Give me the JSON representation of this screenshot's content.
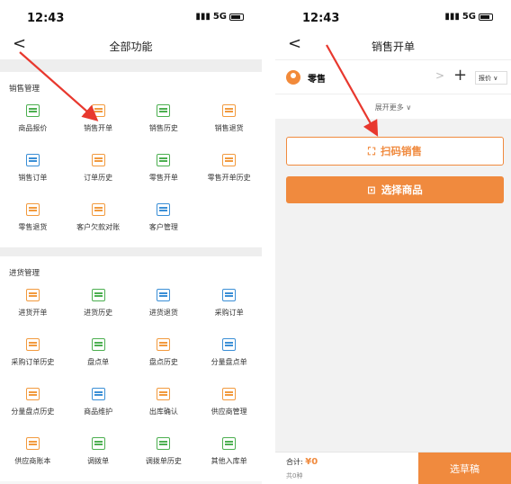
{
  "colors": {
    "accent": "#f08a3e",
    "arrow": "#e8382e",
    "icon_green": "#4caf50",
    "icon_orange": "#f29a3e",
    "icon_blue": "#3b8fd6"
  },
  "left": {
    "status": {
      "time": "12:43",
      "network": "5G"
    },
    "nav": {
      "back": "<",
      "title": "全部功能"
    },
    "sections": [
      {
        "title": "销售管理",
        "items": [
          {
            "label": "商品报价",
            "icon": "price-tag-icon",
            "color": "green"
          },
          {
            "label": "销售开单",
            "icon": "sales-order-icon",
            "color": "orange"
          },
          {
            "label": "销售历史",
            "icon": "history-icon",
            "color": "green"
          },
          {
            "label": "销售退货",
            "icon": "return-icon",
            "color": "orange"
          },
          {
            "label": "销售订单",
            "icon": "list-icon",
            "color": "blue"
          },
          {
            "label": "订单历史",
            "icon": "order-history-icon",
            "color": "orange"
          },
          {
            "label": "零售开单",
            "icon": "retail-order-icon",
            "color": "green"
          },
          {
            "label": "零售开单历史",
            "icon": "retail-history-icon",
            "color": "orange"
          },
          {
            "label": "零售退货",
            "icon": "retail-return-icon",
            "color": "orange"
          },
          {
            "label": "客户欠款对账",
            "icon": "debt-icon",
            "color": "orange"
          },
          {
            "label": "客户管理",
            "icon": "customer-icon",
            "color": "blue"
          }
        ]
      },
      {
        "title": "进货管理",
        "items": [
          {
            "label": "进货开单",
            "icon": "purchase-order-icon",
            "color": "orange"
          },
          {
            "label": "进货历史",
            "icon": "purchase-history-icon",
            "color": "green"
          },
          {
            "label": "进货退货",
            "icon": "box-icon",
            "color": "blue"
          },
          {
            "label": "采购订单",
            "icon": "purchase-list-icon",
            "color": "blue"
          },
          {
            "label": "采购订单历史",
            "icon": "purchase-order-history-icon",
            "color": "orange"
          },
          {
            "label": "盘点单",
            "icon": "clipboard-icon",
            "color": "green"
          },
          {
            "label": "盘点历史",
            "icon": "inventory-history-icon",
            "color": "orange"
          },
          {
            "label": "分量盘点单",
            "icon": "batch-inventory-icon",
            "color": "blue"
          },
          {
            "label": "分量盘点历史",
            "icon": "batch-history-icon",
            "color": "orange"
          },
          {
            "label": "商品维护",
            "icon": "bag-icon",
            "color": "blue"
          },
          {
            "label": "出库确认",
            "icon": "warehouse-icon",
            "color": "orange"
          },
          {
            "label": "供应商管理",
            "icon": "supplier-icon",
            "color": "orange"
          },
          {
            "label": "供应商账本",
            "icon": "ledger-icon",
            "color": "orange"
          },
          {
            "label": "调拨单",
            "icon": "transfer-icon",
            "color": "green"
          },
          {
            "label": "调拨单历史",
            "icon": "transfer-history-icon",
            "color": "green"
          },
          {
            "label": "其他入库单",
            "icon": "inbound-icon",
            "color": "green"
          }
        ]
      }
    ]
  },
  "right": {
    "status": {
      "time": "12:43",
      "network": "5G"
    },
    "nav": {
      "back": "<",
      "title": "销售开单"
    },
    "customer": {
      "name": "零售",
      "chevron": ">",
      "plus": "+",
      "price_select": "报价 ∨"
    },
    "expand": "展开更多 ∨",
    "scan_button": "扫码销售",
    "choose_button": "选择商品",
    "footer": {
      "total_label": "合计:",
      "total_value": "¥0",
      "count": "共0种",
      "draft_button": "选草稿"
    }
  }
}
